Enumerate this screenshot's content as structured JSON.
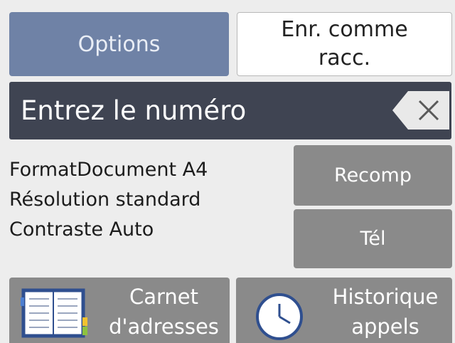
{
  "header": {
    "options_label": "Options",
    "save_label_line1": "Enr. comme",
    "save_label_line2": "racc."
  },
  "entry": {
    "prompt": "Entrez le numéro",
    "backspace_icon": "backspace-icon"
  },
  "settings": [
    "FormatDocument A4",
    "Résolution standard",
    "Contraste Auto"
  ],
  "actions": {
    "redial_label": "Recomp",
    "tel_label": "Tél"
  },
  "bottom": {
    "address_line1": "Carnet",
    "address_line2": "d'adresses",
    "address_icon": "address-book-icon",
    "history_line1": "Historique",
    "history_line2": "appels",
    "history_icon": "clock-icon"
  },
  "colors": {
    "options_button": "#6f82a6",
    "entry_bar": "#3f4452",
    "grey_button": "#8a8a8a",
    "background": "#ededed"
  }
}
